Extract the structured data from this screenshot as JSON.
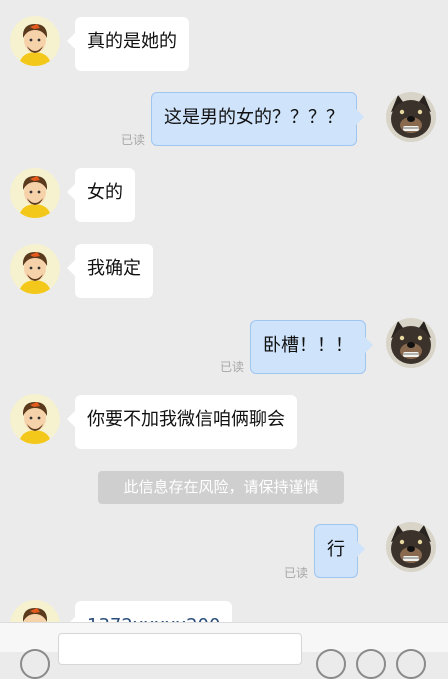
{
  "messages": [
    {
      "side": "left",
      "text": "真的是她的"
    },
    {
      "side": "right",
      "text": "这是男的女的？？？？",
      "status": "已读"
    },
    {
      "side": "left",
      "text": "女的"
    },
    {
      "side": "left",
      "text": "我确定"
    },
    {
      "side": "right",
      "text": "卧槽！！！",
      "status": "已读"
    },
    {
      "side": "left",
      "text": "你要不加我微信咱俩聊会"
    },
    {
      "side": "right",
      "text": "行",
      "status": "已读"
    },
    {
      "side": "left",
      "text": "1372xxxxx200"
    }
  ],
  "system_notice": "此信息存在风险，请保持谨慎",
  "colors": {
    "background": "#ebebeb",
    "incoming_bubble": "#ffffff",
    "outgoing_bubble": "#cfe3fb",
    "notice_bg": "#cfcfcf"
  },
  "icons": {
    "contact_avatar": "cartoon-boy-avatar",
    "self_avatar": "dog-avatar"
  }
}
